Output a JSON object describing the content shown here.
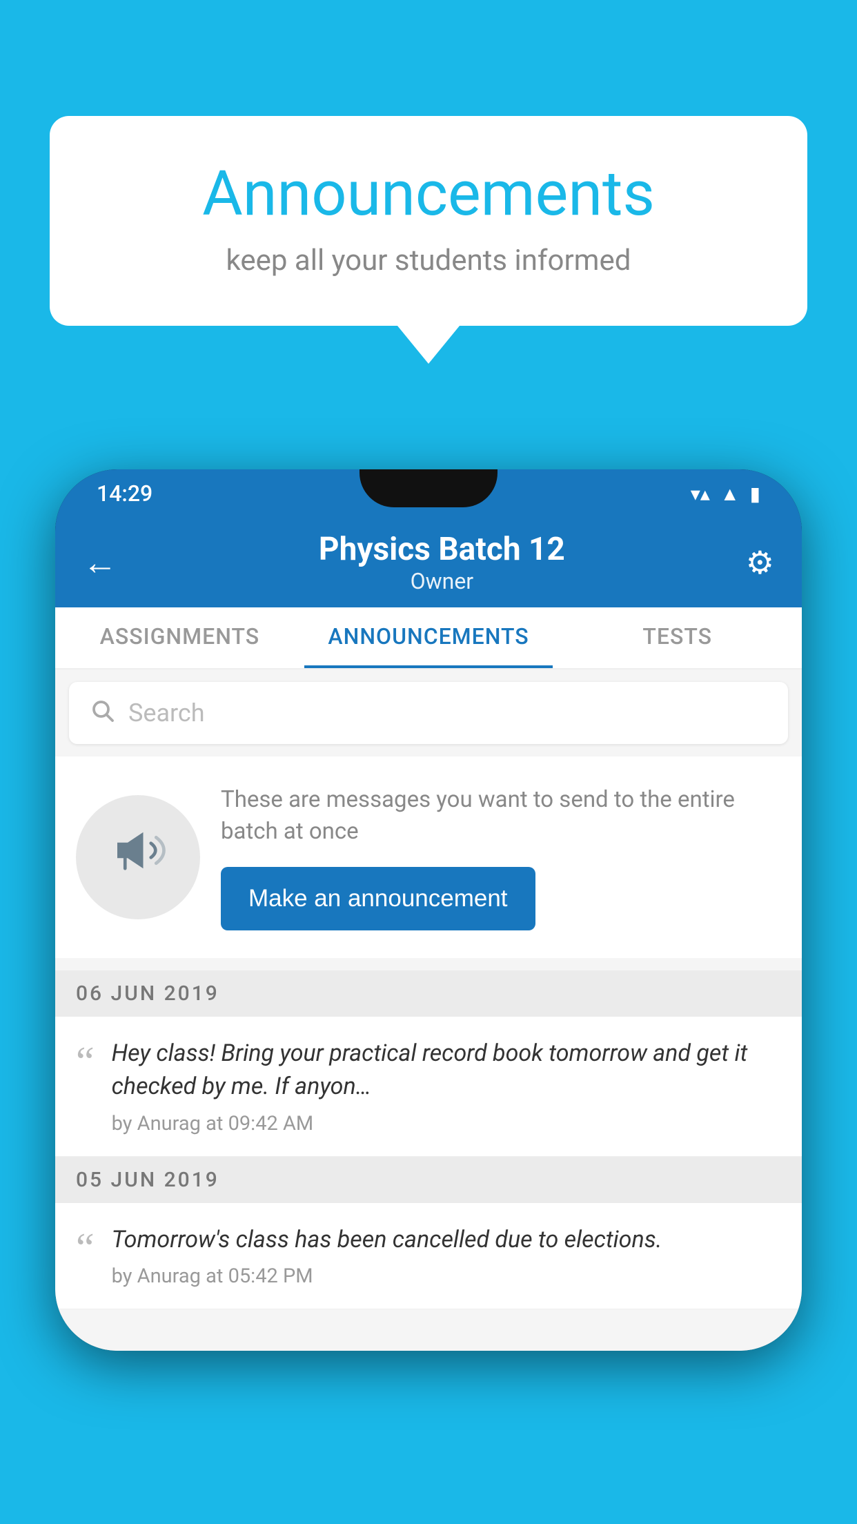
{
  "bubble": {
    "title": "Announcements",
    "subtitle": "keep all your students informed"
  },
  "status_bar": {
    "time": "14:29",
    "icons": [
      "wifi",
      "signal",
      "battery"
    ]
  },
  "app_bar": {
    "title": "Physics Batch 12",
    "subtitle": "Owner",
    "back_label": "←",
    "settings_label": "⚙"
  },
  "tabs": [
    {
      "label": "ASSIGNMENTS",
      "active": false
    },
    {
      "label": "ANNOUNCEMENTS",
      "active": true
    },
    {
      "label": "TESTS",
      "active": false
    }
  ],
  "search": {
    "placeholder": "Search"
  },
  "intro": {
    "description": "These are messages you want to send to the entire batch at once",
    "button_label": "Make an announcement"
  },
  "announcements": [
    {
      "date": "06  JUN  2019",
      "text": "Hey class! Bring your practical record book tomorrow and get it checked by me. If anyon…",
      "meta": "by Anurag at 09:42 AM"
    },
    {
      "date": "05  JUN  2019",
      "text": "Tomorrow's class has been cancelled due to elections.",
      "meta": "by Anurag at 05:42 PM"
    }
  ]
}
